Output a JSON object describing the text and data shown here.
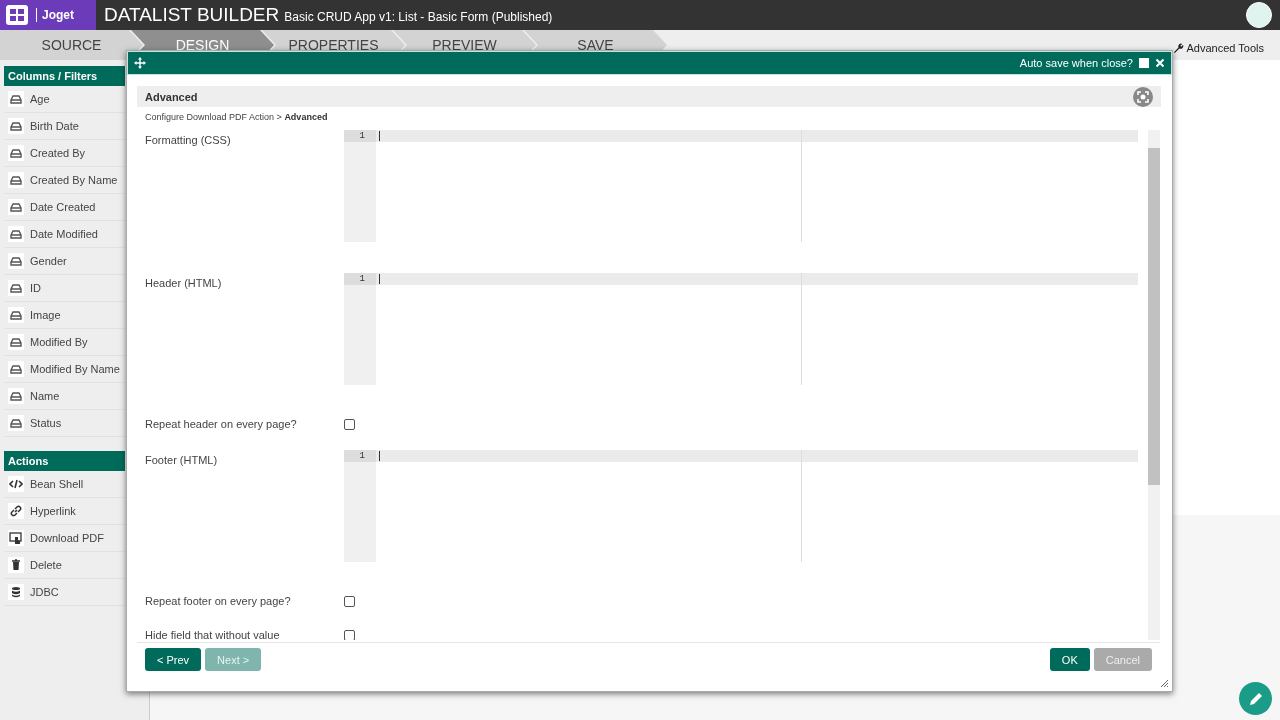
{
  "app": {
    "logo": "Joget",
    "title": "DATALIST BUILDER",
    "subtitle": "Basic CRUD App v1: List - Basic Form (Published)"
  },
  "steps": [
    {
      "label": "SOURCE",
      "selected": false
    },
    {
      "label": "DESIGN",
      "selected": true
    },
    {
      "label": "PROPERTIES",
      "selected": false
    },
    {
      "label": "PREVIEW",
      "selected": false
    },
    {
      "label": "SAVE",
      "selected": false
    }
  ],
  "toolbar": {
    "advanced_tools": "Advanced Tools"
  },
  "palette": [
    {
      "title": "Columns / Filters",
      "items": [
        {
          "label": "Age",
          "kind": "column"
        },
        {
          "label": "Birth Date",
          "kind": "column"
        },
        {
          "label": "Created By",
          "kind": "column"
        },
        {
          "label": "Created By Name",
          "kind": "column"
        },
        {
          "label": "Date Created",
          "kind": "column"
        },
        {
          "label": "Date Modified",
          "kind": "column"
        },
        {
          "label": "Gender",
          "kind": "column"
        },
        {
          "label": "ID",
          "kind": "column"
        },
        {
          "label": "Image",
          "kind": "column"
        },
        {
          "label": "Modified By",
          "kind": "column"
        },
        {
          "label": "Modified By Name",
          "kind": "column"
        },
        {
          "label": "Name",
          "kind": "column"
        },
        {
          "label": "Status",
          "kind": "column"
        }
      ]
    },
    {
      "title": "Actions",
      "items": [
        {
          "label": "Bean Shell",
          "kind": "code"
        },
        {
          "label": "Hyperlink",
          "kind": "link"
        },
        {
          "label": "Download PDF",
          "kind": "pdf"
        },
        {
          "label": "Delete",
          "kind": "delete"
        },
        {
          "label": "JDBC",
          "kind": "database"
        }
      ]
    }
  ],
  "dialog": {
    "auto_save": {
      "label": "Auto save when close?",
      "checked": false
    },
    "section_title": "Advanced",
    "breadcrumb": {
      "parent": "Configure Download PDF Action",
      "separator": ">",
      "current": "Advanced"
    },
    "fields": [
      {
        "label": "Formatting (CSS)",
        "kind": "code",
        "line_number": "1"
      },
      {
        "label": "Header (HTML)",
        "kind": "code",
        "line_number": "1"
      },
      {
        "label": "Repeat header on every page?",
        "kind": "checkbox",
        "checked": false
      },
      {
        "label": "Footer (HTML)",
        "kind": "code",
        "line_number": "1"
      },
      {
        "label": "Repeat footer on every page?",
        "kind": "checkbox",
        "checked": false
      },
      {
        "label": "Hide field that without value",
        "kind": "checkbox",
        "checked": false
      }
    ],
    "nav_buttons": [
      {
        "label": "< Prev",
        "disabled": false
      },
      {
        "label": "Next >",
        "disabled": true
      }
    ],
    "buttons": [
      {
        "label": "OK",
        "kind": "primary"
      },
      {
        "label": "Cancel",
        "kind": "secondary"
      }
    ]
  }
}
